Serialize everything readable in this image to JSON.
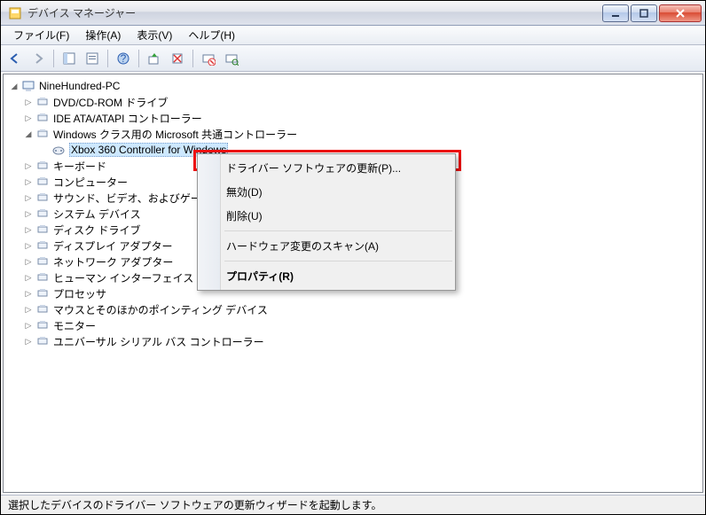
{
  "titlebar": {
    "title": "デバイス マネージャー"
  },
  "menu": {
    "file": "ファイル(F)",
    "action": "操作(A)",
    "view": "表示(V)",
    "help": "ヘルプ(H)"
  },
  "tree": {
    "root": "NineHundred-PC",
    "items": [
      "DVD/CD-ROM ドライブ",
      "IDE ATA/ATAPI コントローラー",
      "Windows クラス用の Microsoft 共通コントローラー",
      "キーボード",
      "コンピューター",
      "サウンド、ビデオ、およびゲーム コントローラー",
      "システム デバイス",
      "ディスク ドライブ",
      "ディスプレイ アダプター",
      "ネットワーク アダプター",
      "ヒューマン インターフェイス デバイス",
      "プロセッサ",
      "マウスとそのほかのポインティング デバイス",
      "モニター",
      "ユニバーサル シリアル バス コントローラー"
    ],
    "expanded_child": "Xbox 360 Controller for Windows"
  },
  "context_menu": {
    "update_driver": "ドライバー ソフトウェアの更新(P)...",
    "disable": "無効(D)",
    "uninstall": "削除(U)",
    "scan": "ハードウェア変更のスキャン(A)",
    "properties": "プロパティ(R)"
  },
  "statusbar": {
    "text": "選択したデバイスのドライバー ソフトウェアの更新ウィザードを起動します。"
  }
}
